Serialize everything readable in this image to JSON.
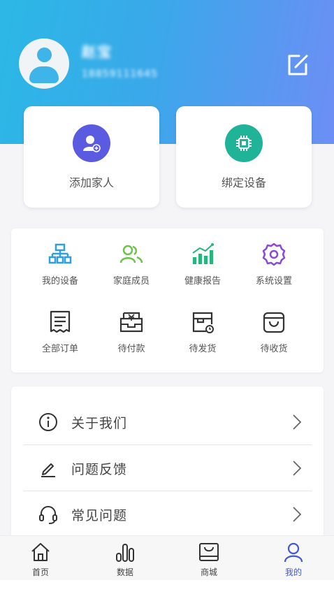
{
  "header": {
    "user_name": "赵宝",
    "user_phone": "18859111645",
    "gradient_start": "#2bb8e6",
    "gradient_end": "#6d8ef5"
  },
  "cards": [
    {
      "label": "添加家人",
      "icon": "add-user-icon",
      "color": "#5a5be0"
    },
    {
      "label": "绑定设备",
      "icon": "chip-icon",
      "color": "#1fb497"
    }
  ],
  "grid": [
    {
      "label": "我的设备",
      "icon": "device-tree-icon",
      "color": "#2f9fe0"
    },
    {
      "label": "家庭成员",
      "icon": "family-icon",
      "color": "#6cc24a"
    },
    {
      "label": "健康报告",
      "icon": "chart-icon",
      "color": "#26b57a"
    },
    {
      "label": "系统设置",
      "icon": "gear-icon",
      "color": "#8a49d8"
    },
    {
      "label": "全部订单",
      "icon": "receipt-icon",
      "color": "#333333"
    },
    {
      "label": "待付款",
      "icon": "wallet-icon",
      "color": "#333333"
    },
    {
      "label": "待发货",
      "icon": "box-clock-icon",
      "color": "#333333"
    },
    {
      "label": "待收货",
      "icon": "bag-icon",
      "color": "#333333"
    }
  ],
  "list": [
    {
      "label": "关于我们",
      "icon": "info-icon"
    },
    {
      "label": "问题反馈",
      "icon": "pen-icon"
    },
    {
      "label": "常见问题",
      "icon": "headset-icon"
    }
  ],
  "tabs": [
    {
      "label": "首页",
      "icon": "home-icon",
      "active": false
    },
    {
      "label": "数据",
      "icon": "bars-icon",
      "active": false
    },
    {
      "label": "商城",
      "icon": "shop-icon",
      "active": false
    },
    {
      "label": "我的",
      "icon": "person-icon",
      "active": true
    }
  ],
  "accent_color": "#4457d6"
}
